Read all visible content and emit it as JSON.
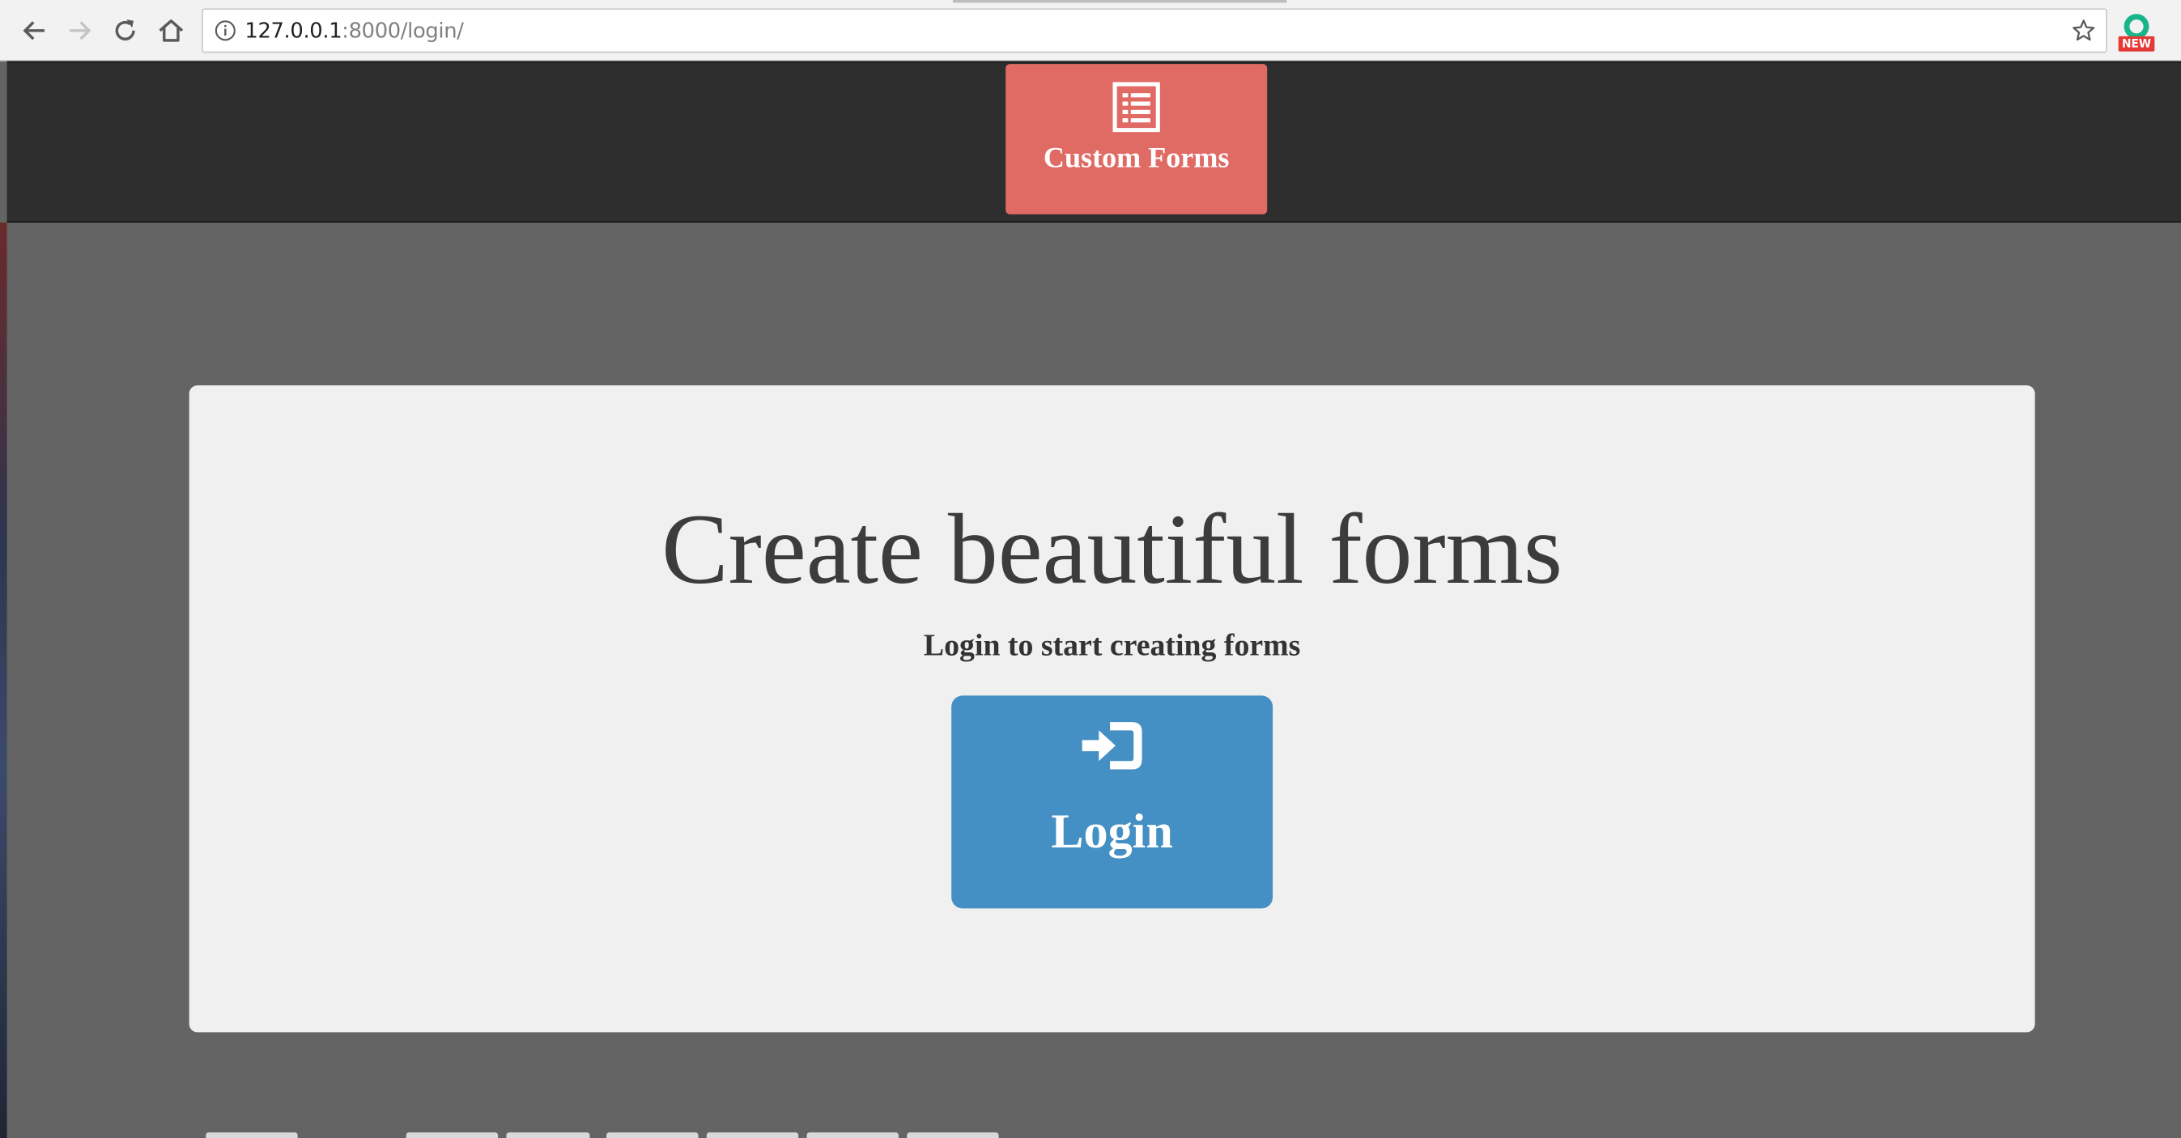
{
  "browser": {
    "url_host": "127.0.0.1",
    "url_path": ":8000/login/",
    "icons": {
      "back": "arrow-left-icon",
      "forward": "arrow-right-icon",
      "reload": "reload-icon",
      "home": "home-icon",
      "info": "info-icon",
      "bookmark": "star-icon",
      "extension": "grammarly-icon"
    },
    "extension_badge": "NEW"
  },
  "navbar": {
    "brand_label": "Custom Forms",
    "brand_icon": "list-form-icon",
    "brand_color": "#e06b65",
    "background": "#2e2e2e"
  },
  "hero": {
    "title": "Create beautiful forms",
    "subtitle": "Login to start creating forms",
    "login_label": "Login",
    "login_icon": "sign-in-icon",
    "login_color": "#4490c4"
  }
}
